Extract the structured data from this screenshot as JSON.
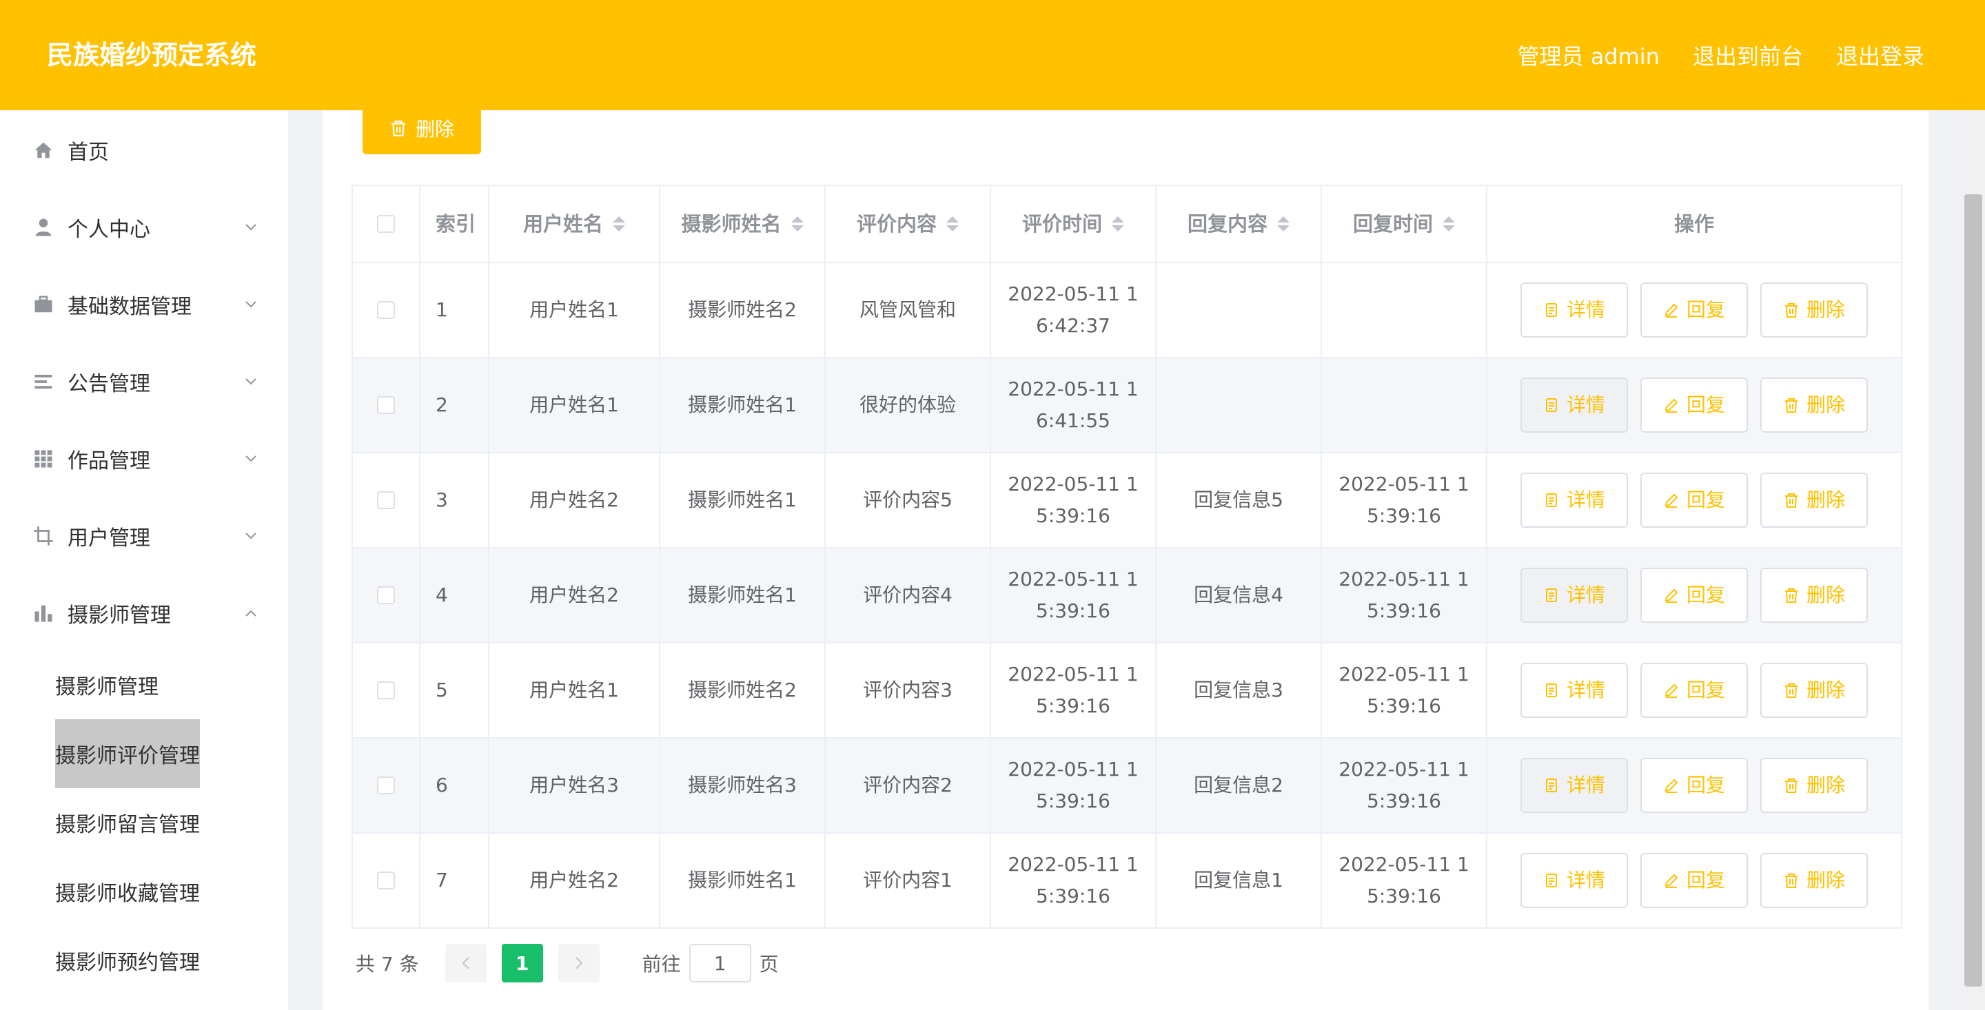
{
  "header": {
    "title": "民族婚纱预定系统",
    "links": [
      "管理员 admin",
      "退出到前台",
      "退出登录"
    ]
  },
  "colors": {
    "brand": "#ffc100",
    "pagination_active": "#19be6b"
  },
  "sidebar": {
    "items": [
      {
        "label": "首页",
        "icon": "home-icon"
      },
      {
        "label": "个人中心",
        "icon": "user-icon",
        "arrow": "chevron-down"
      },
      {
        "label": "基础数据管理",
        "icon": "briefcase-icon",
        "arrow": "chevron-down"
      },
      {
        "label": "公告管理",
        "icon": "list-icon",
        "arrow": "chevron-down"
      },
      {
        "label": "作品管理",
        "icon": "grid-icon",
        "arrow": "chevron-down"
      },
      {
        "label": "用户管理",
        "icon": "crop-icon",
        "arrow": "chevron-down"
      },
      {
        "label": "摄影师管理",
        "icon": "bar-chart-icon",
        "arrow": "chevron-up"
      }
    ],
    "subitems": [
      "摄影师管理",
      "摄影师评价管理",
      "摄影师留言管理",
      "摄影师收藏管理",
      "摄影师预约管理"
    ],
    "active_subitem": "摄影师评价管理"
  },
  "toolbar": {
    "delete_label": "删除"
  },
  "table": {
    "headers": [
      "索引",
      "用户姓名",
      "摄影师姓名",
      "评价内容",
      "评价时间",
      "回复内容",
      "回复时间",
      "操作"
    ],
    "rows": [
      {
        "index": "1",
        "user": "用户姓名1",
        "photographer": "摄影师姓名2",
        "content": "风管风管和",
        "time1": "2022-05-11 1",
        "time2": "6:42:37",
        "reply": "",
        "rtime1": "",
        "rtime2": ""
      },
      {
        "index": "2",
        "user": "用户姓名1",
        "photographer": "摄影师姓名1",
        "content": "很好的体验",
        "time1": "2022-05-11 1",
        "time2": "6:41:55",
        "reply": "",
        "rtime1": "",
        "rtime2": ""
      },
      {
        "index": "3",
        "user": "用户姓名2",
        "photographer": "摄影师姓名1",
        "content": "评价内容5",
        "time1": "2022-05-11 1",
        "time2": "5:39:16",
        "reply": "回复信息5",
        "rtime1": "2022-05-11 1",
        "rtime2": "5:39:16"
      },
      {
        "index": "4",
        "user": "用户姓名2",
        "photographer": "摄影师姓名1",
        "content": "评价内容4",
        "time1": "2022-05-11 1",
        "time2": "5:39:16",
        "reply": "回复信息4",
        "rtime1": "2022-05-11 1",
        "rtime2": "5:39:16"
      },
      {
        "index": "5",
        "user": "用户姓名1",
        "photographer": "摄影师姓名2",
        "content": "评价内容3",
        "time1": "2022-05-11 1",
        "time2": "5:39:16",
        "reply": "回复信息3",
        "rtime1": "2022-05-11 1",
        "rtime2": "5:39:16"
      },
      {
        "index": "6",
        "user": "用户姓名3",
        "photographer": "摄影师姓名3",
        "content": "评价内容2",
        "time1": "2022-05-11 1",
        "time2": "5:39:16",
        "reply": "回复信息2",
        "rtime1": "2022-05-11 1",
        "rtime2": "5:39:16"
      },
      {
        "index": "7",
        "user": "用户姓名2",
        "photographer": "摄影师姓名1",
        "content": "评价内容1",
        "time1": "2022-05-11 1",
        "time2": "5:39:16",
        "reply": "回复信息1",
        "rtime1": "2022-05-11 1",
        "rtime2": "5:39:16"
      }
    ],
    "actions": {
      "detail": "详情",
      "reply": "回复",
      "delete": "删除"
    }
  },
  "pagination": {
    "total": "共 7 条",
    "current_page": "1",
    "goto_label": "前往",
    "goto_value": "1",
    "page_suffix": "页"
  }
}
